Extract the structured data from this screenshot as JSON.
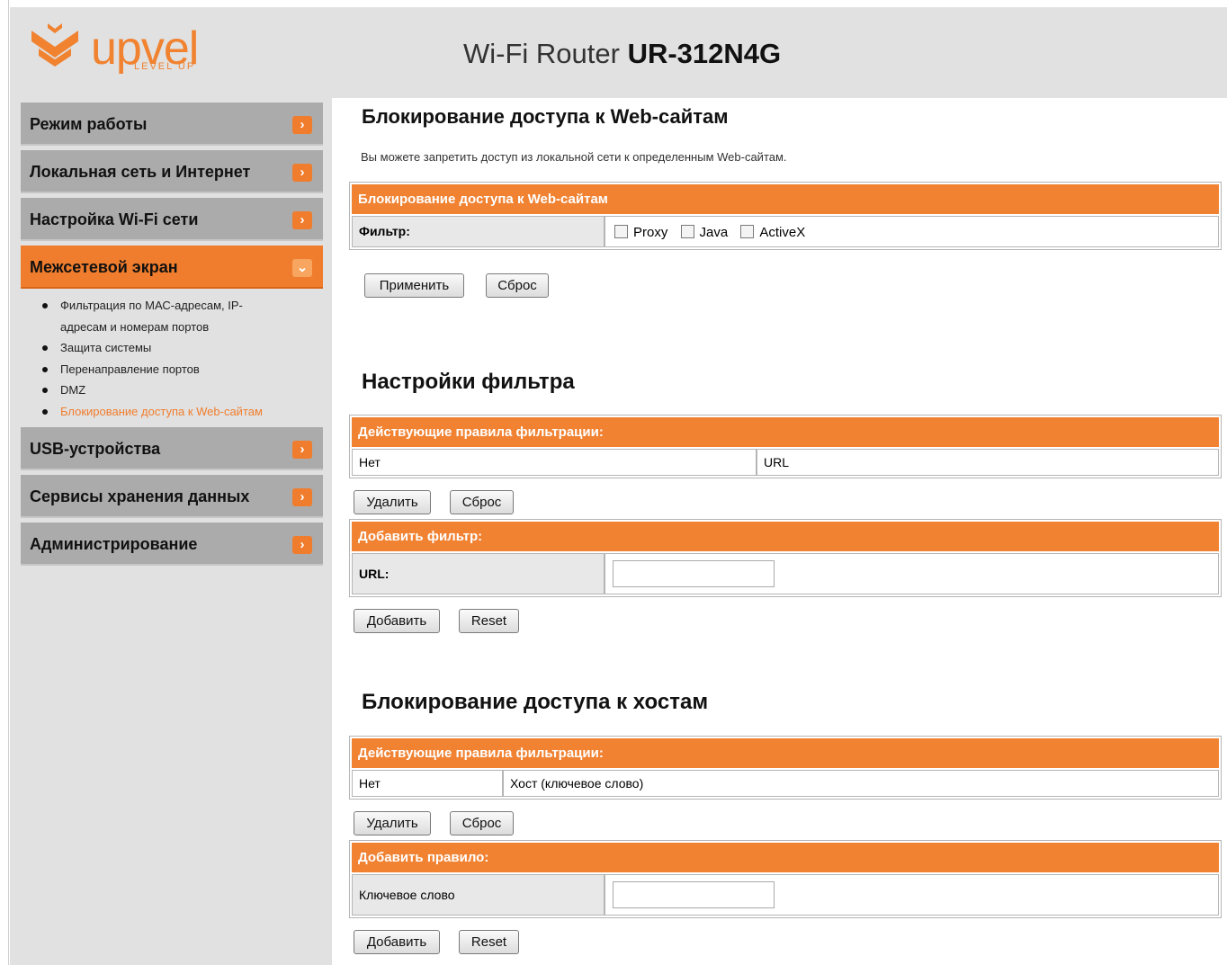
{
  "header": {
    "logo_text": "upvel",
    "logo_tagline": "LEVEL UP",
    "title_prefix": "Wi-Fi Router ",
    "title_model": "UR-312N4G"
  },
  "sidebar": {
    "items": [
      {
        "label": "Режим работы"
      },
      {
        "label": "Локальная сеть и Интернет"
      },
      {
        "label": "Настройка Wi-Fi сети"
      },
      {
        "label": "Межсетевой экран"
      },
      {
        "label": "USB-устройства"
      },
      {
        "label": "Сервисы хранения данных"
      },
      {
        "label": "Администрирование"
      }
    ],
    "subitems": [
      "Фильтрация по МАС-адресам, IP-адресам и номерам портов",
      "Защита системы",
      "Перенаправление портов",
      "DMZ",
      "Блокирование доступа к Web-сайтам"
    ],
    "colors": {
      "accent": "#f07d2d",
      "panel": "#e1e1e1",
      "item": "#ababab"
    }
  },
  "main": {
    "section1": {
      "heading": "Блокирование доступа к Web-сайтам",
      "description": "Вы можете запретить доступ из локальной сети к определенным Web-сайтам.",
      "table_title": "Блокирование доступа к Web-сайтам",
      "filter_label": "Фильтр:",
      "options": [
        "Proxy",
        "Java",
        "ActiveX"
      ],
      "apply_button": "Применить",
      "reset_button": "Сброс"
    },
    "section2": {
      "heading": "Настройки фильтра",
      "rules_title": "Действующие правила фильтрации:",
      "col_none": "Нет",
      "col_url": "URL",
      "delete_button": "Удалить",
      "reset_button": "Сброс",
      "add_title": "Добавить фильтр:",
      "url_label": "URL:",
      "url_value": "",
      "add_button": "Добавить",
      "reset2_button": "Reset"
    },
    "section3": {
      "heading": "Блокирование доступа к хостам",
      "rules_title": "Действующие правила фильтрации:",
      "col_none": "Нет",
      "col_host": "Хост (ключевое слово)",
      "delete_button": "Удалить",
      "reset_button": "Сброс",
      "add_title": "Добавить правило:",
      "keyword_label": "Ключевое слово",
      "keyword_value": "",
      "add_button": "Добавить",
      "reset2_button": "Reset"
    }
  }
}
